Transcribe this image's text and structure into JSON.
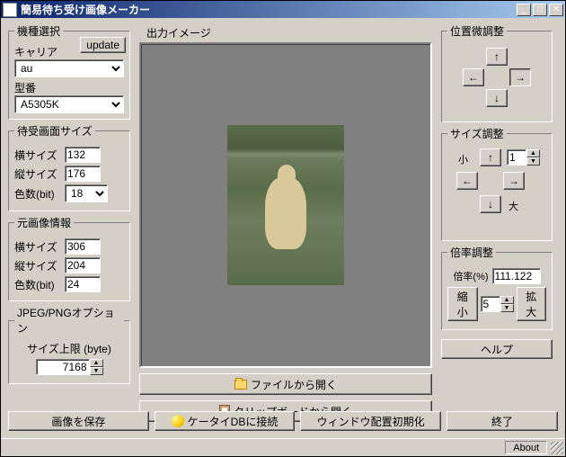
{
  "title": "簡易待ち受け画像メーカー",
  "model_select": {
    "legend": "機種選択",
    "update_btn": "update",
    "carrier_label": "キャリア",
    "carrier_value": "au",
    "model_label": "型番",
    "model_value": "A5305K"
  },
  "screen_size": {
    "legend": "待受画面サイズ",
    "w_label": "横サイズ",
    "w_value": "132",
    "h_label": "縦サイズ",
    "h_value": "176",
    "bits_label": "色数(bit)",
    "bits_value": "18"
  },
  "source_info": {
    "legend": "元画像情報",
    "w_label": "横サイズ",
    "w_value": "306",
    "h_label": "縦サイズ",
    "h_value": "204",
    "bits_label": "色数(bit)",
    "bits_value": "24"
  },
  "jpeg_opts": {
    "legend": "JPEG/PNGオプション",
    "limit_label": "サイズ上限 (byte)",
    "limit_value": "7168"
  },
  "output_label": "出力イメージ",
  "open_file_btn": "ファイルから開く",
  "open_clipboard_btn": "クリップボードから開く",
  "pos_adjust": {
    "legend": "位置微調整",
    "up": "↑",
    "down": "↓",
    "left": "←",
    "right": "→"
  },
  "size_adjust": {
    "legend": "サイズ調整",
    "small": "小",
    "large": "大",
    "up": "↑",
    "down": "↓",
    "left": "←",
    "right": "→",
    "value": "1"
  },
  "ratio_adjust": {
    "legend": "倍率調整",
    "ratio_label": "倍率(%)",
    "ratio_value": "111.122",
    "shrink": "縮小",
    "enlarge": "拡大",
    "step_value": "5"
  },
  "help_btn": "ヘルプ",
  "save_btn": "画像を保存",
  "connect_btn": "ケータイDBに接続",
  "reset_btn": "ウィンドウ配置初期化",
  "exit_btn": "終了",
  "status_about": "About"
}
